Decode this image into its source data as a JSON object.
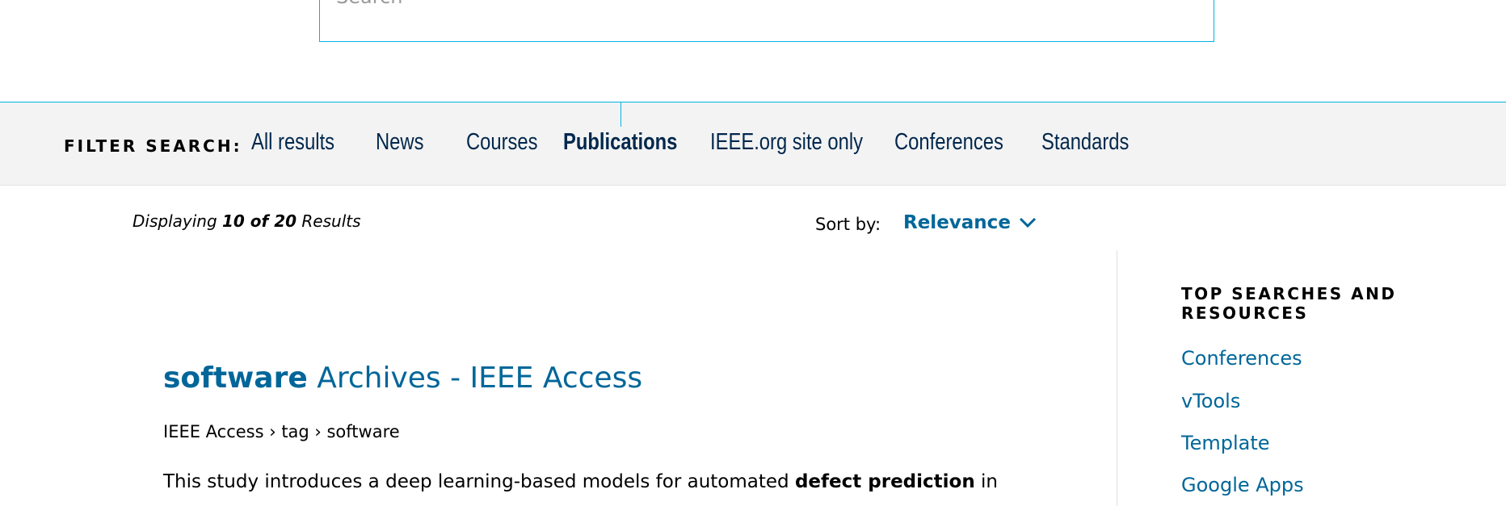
{
  "search": {
    "placeholder": "Search"
  },
  "filter": {
    "label": "FILTER SEARCH:",
    "items": [
      {
        "label": "All results",
        "active": false
      },
      {
        "label": "News",
        "active": false
      },
      {
        "label": "Courses",
        "active": false
      },
      {
        "label": "Publications",
        "active": true
      },
      {
        "label": "IEEE.org site only",
        "active": false
      },
      {
        "label": "Conferences",
        "active": false
      },
      {
        "label": "Standards",
        "active": false
      }
    ]
  },
  "results_header": {
    "displaying_prefix": "Displaying",
    "displaying_count": "10 of 20",
    "displaying_suffix": "Results",
    "sort_label": "Sort by:",
    "sort_value": "Relevance"
  },
  "result": {
    "title_keyword": "software",
    "title_rest": "Archives - IEEE Access",
    "breadcrumb": "IEEE Access › tag › software",
    "snippet_start": "This study introduces a deep learning-based models for automated",
    "snippet_bold": "defect prediction",
    "snippet_end": "in"
  },
  "sidebar": {
    "heading": "TOP SEARCHES AND RESOURCES",
    "links": [
      "Conferences",
      "vTools",
      "Template",
      "Google Apps"
    ]
  },
  "colors": {
    "accent_line": "#00b5e2",
    "link": "#006699",
    "nav_text": "#00274c",
    "filter_bg": "#f3f3f3"
  },
  "icons": {
    "search": "search-icon",
    "sort": "chevron-down-icon"
  }
}
